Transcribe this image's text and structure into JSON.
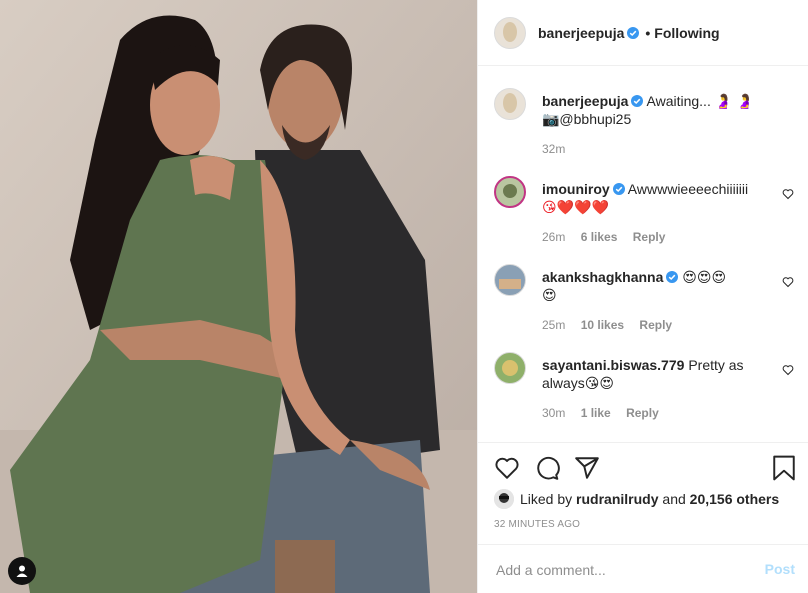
{
  "post": {
    "author": "banerjeepuja",
    "follow_status": "Following",
    "dot": "•",
    "caption_text": "Awaiting... 🤰 🤰",
    "caption_line2": "📷@bbhupi25",
    "caption_time": "32m"
  },
  "comments": [
    {
      "user": "imouniroy",
      "verified": true,
      "text": "Awwwwieeeechiiiiiii",
      "text2": "😘❤️❤️❤️",
      "time": "26m",
      "likes": "6 likes",
      "reply": "Reply"
    },
    {
      "user": "akankshagkhanna",
      "verified": true,
      "text": "😍😍😍",
      "text2": "😍",
      "time": "25m",
      "likes": "10 likes",
      "reply": "Reply"
    },
    {
      "user": "sayantani.biswas.779",
      "verified": false,
      "text": "Pretty as",
      "text2": "always😘😍",
      "time": "30m",
      "likes": "1 like",
      "reply": "Reply"
    }
  ],
  "likes": {
    "prefix": "Liked by",
    "user": "rudranilrudy",
    "middle": "and",
    "count": "20,156 others"
  },
  "timestamp": "32 MINUTES AGO",
  "comment_box": {
    "placeholder": "Add a comment...",
    "post_label": "Post"
  },
  "colors": {
    "verified_blue": "#3897f0",
    "post_disabled": "#b2dffc",
    "muted": "#8e8e8e"
  },
  "icons": [
    "user-tag-icon",
    "heart-icon",
    "comment-icon",
    "share-icon",
    "bookmark-icon",
    "verified-icon",
    "comment-like-icon"
  ]
}
